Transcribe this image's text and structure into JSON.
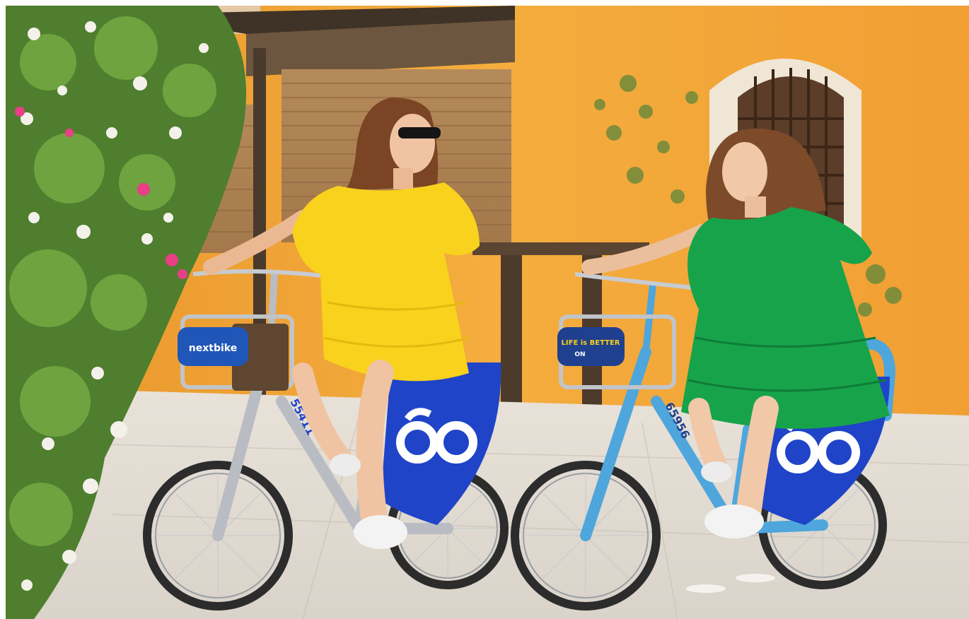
{
  "photo": {
    "bike_left": {
      "basket_sign": "nextbike",
      "frame_number": "55411"
    },
    "bike_right": {
      "basket_sign_line1": "LIFE is BETTER",
      "basket_sign_line2": "ON",
      "frame_number": "65956"
    }
  },
  "colors": {
    "wall": "#f2a73a",
    "wall_shadow": "#d98b22",
    "pavement": "#e6e1da",
    "brand_blue": "#1f44c8",
    "yellow_dress": "#f8d21c",
    "green_dress": "#17a34a",
    "bike_light_blue": "#4fa6dc",
    "bike_silver": "#b9bcc2"
  }
}
